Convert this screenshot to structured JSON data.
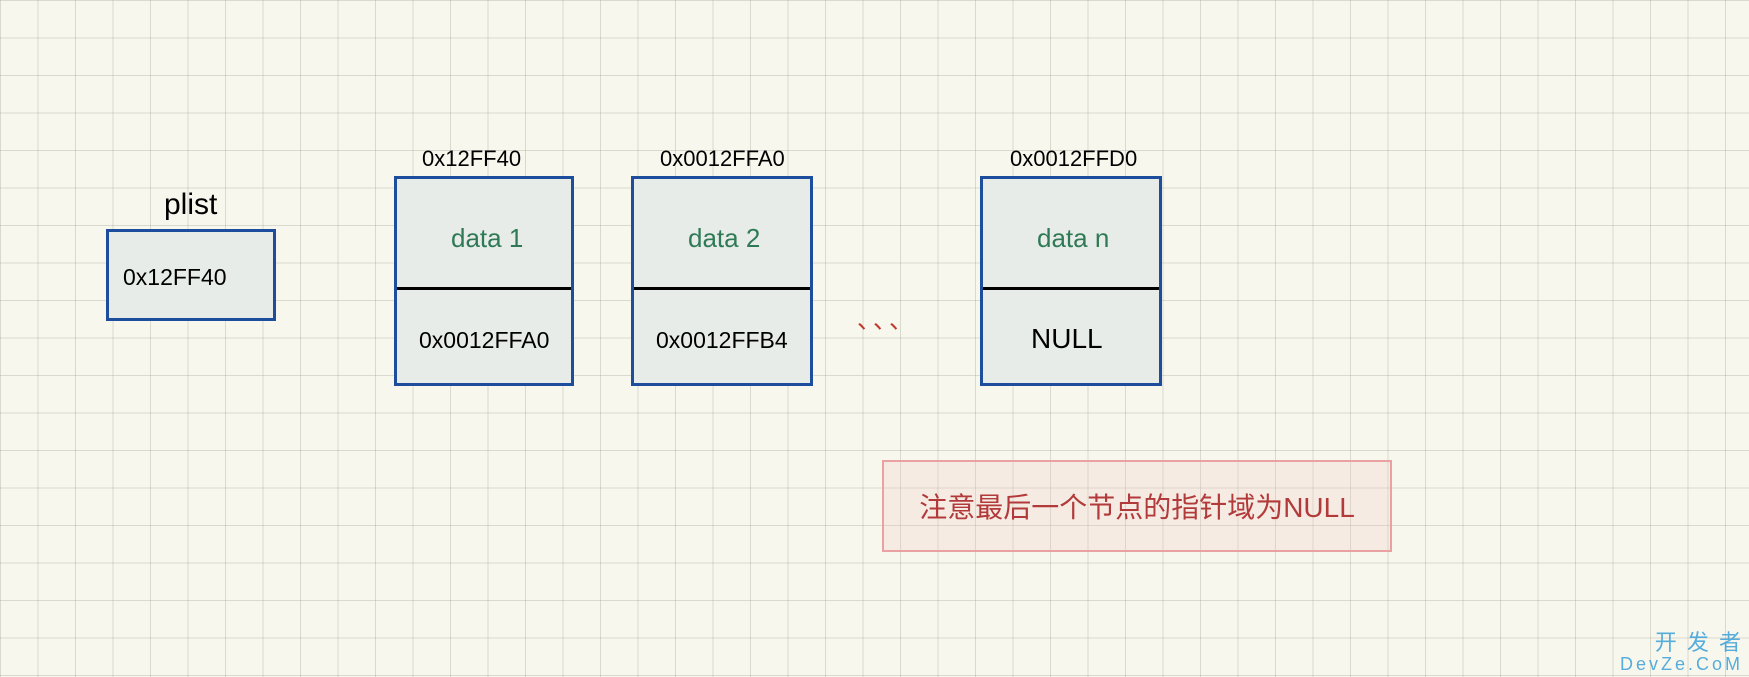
{
  "plist": {
    "label": "plist",
    "value": "0x12FF40"
  },
  "nodes": [
    {
      "top_addr": "0x12FF40",
      "data": "data 1",
      "next": "0x0012FFA0"
    },
    {
      "top_addr": "0x0012FFA0",
      "data": "data 2",
      "next": "0x0012FFB4"
    },
    {
      "top_addr": "0x0012FFD0",
      "data": "data n",
      "next": "NULL"
    }
  ],
  "ellipsis": "、、、",
  "note": "注意最后一个节点的指针域为NULL",
  "watermark": {
    "line1": "开 发 者",
    "line2": "DevZe.CoM"
  }
}
